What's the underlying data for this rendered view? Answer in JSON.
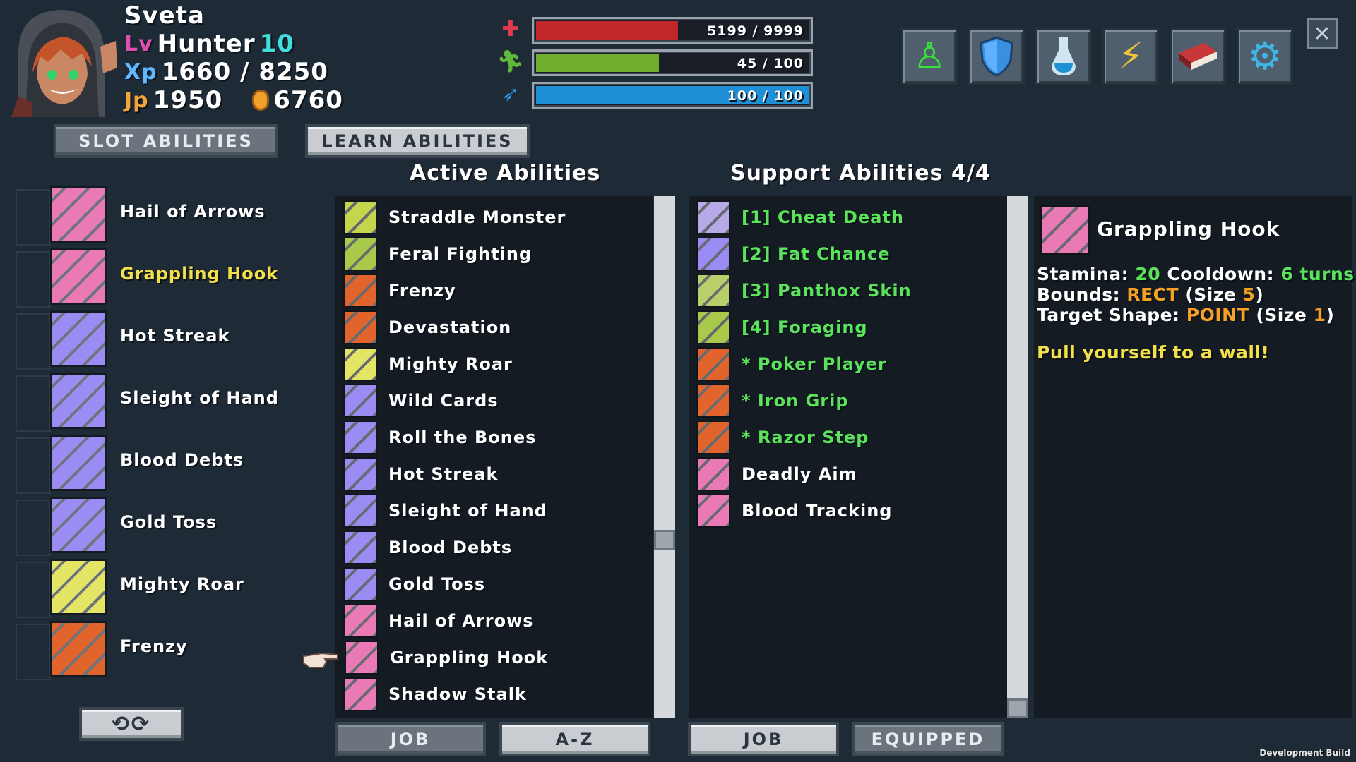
{
  "character": {
    "name": "Sveta",
    "lv_tag": "Lv",
    "job": "Hunter",
    "level": "10",
    "xp_tag": "Xp",
    "xp": "1660 / 8250",
    "jp_tag": "Jp",
    "jp": "1950",
    "gold": "6760"
  },
  "stats": {
    "hp": {
      "text": "5199 / 9999",
      "fraction": 0.52,
      "color": "#c0262a",
      "icon": "plus-icon"
    },
    "stamina": {
      "text": "45 / 100",
      "fraction": 0.45,
      "color": "#6fae2c",
      "icon": "running-man-icon"
    },
    "mana": {
      "text": "100 / 100",
      "fraction": 1.0,
      "color": "#1f8fd6",
      "icon": "feather-icon"
    }
  },
  "top_icons": [
    "character-icon",
    "shield-icon",
    "potion-icon",
    "skills-icon",
    "spellbook-icon",
    "settings-icon"
  ],
  "tabs": {
    "slot": "SLOT ABILITIES",
    "learn": "LEARN ABILITIES"
  },
  "headings": {
    "active": "Active Abilities",
    "support": "Support Abilities 4/4"
  },
  "slotted": [
    {
      "label": "Hail of Arrows",
      "color": "#e97ab6",
      "highlight": false
    },
    {
      "label": "Grappling Hook",
      "color": "#e97ab6",
      "highlight": true
    },
    {
      "label": "Hot Streak",
      "color": "#9a8cf2",
      "highlight": false
    },
    {
      "label": "Sleight of Hand",
      "color": "#9a8cf2",
      "highlight": false
    },
    {
      "label": "Blood Debts",
      "color": "#9a8cf2",
      "highlight": false
    },
    {
      "label": "Gold Toss",
      "color": "#9a8cf2",
      "highlight": false
    },
    {
      "label": "Mighty Roar",
      "color": "#e4e465",
      "highlight": false
    },
    {
      "label": "Frenzy",
      "color": "#e2642d",
      "highlight": false
    }
  ],
  "active_list": [
    {
      "label": "Straddle Monster",
      "color": "#c6d64c"
    },
    {
      "label": "Feral Fighting",
      "color": "#a8c94a"
    },
    {
      "label": "Frenzy",
      "color": "#e2642d"
    },
    {
      "label": "Devastation",
      "color": "#e2642d"
    },
    {
      "label": "Mighty Roar",
      "color": "#e4e465"
    },
    {
      "label": "Wild Cards",
      "color": "#9a8cf2"
    },
    {
      "label": "Roll the Bones",
      "color": "#9a8cf2"
    },
    {
      "label": "Hot Streak",
      "color": "#9a8cf2"
    },
    {
      "label": "Sleight of Hand",
      "color": "#9a8cf2"
    },
    {
      "label": "Blood Debts",
      "color": "#9a8cf2"
    },
    {
      "label": "Gold Toss",
      "color": "#9a8cf2"
    },
    {
      "label": "Hail of Arrows",
      "color": "#e97ab6"
    },
    {
      "label": "Grappling Hook",
      "color": "#e97ab6"
    },
    {
      "label": "Shadow Stalk",
      "color": "#e97ab6"
    }
  ],
  "support_list": [
    {
      "label": "[1] Cheat Death",
      "color": "#b7a8e8",
      "equipped": true
    },
    {
      "label": "[2] Fat Chance",
      "color": "#9a8cf2",
      "equipped": true
    },
    {
      "label": "[3] Panthox Skin",
      "color": "#b9cf6a",
      "equipped": true
    },
    {
      "label": "[4] Foraging",
      "color": "#a8c94a",
      "equipped": true
    },
    {
      "label": "* Poker Player",
      "color": "#e2642d",
      "equipped": true
    },
    {
      "label": "* Iron Grip",
      "color": "#e2642d",
      "equipped": true
    },
    {
      "label": "* Razor Step",
      "color": "#e2642d",
      "equipped": true
    },
    {
      "label": "Deadly Aim",
      "color": "#e97ab6",
      "equipped": false
    },
    {
      "label": "Blood Tracking",
      "color": "#e97ab6",
      "equipped": false
    }
  ],
  "detail": {
    "name": "Grappling Hook",
    "stamina_label": "Stamina:",
    "stamina_value": "20",
    "cooldown_label": "Cooldown:",
    "cooldown_value": "6 turns",
    "bounds_label": "Bounds:",
    "bounds_shape": "RECT",
    "bounds_size_open": "(Size ",
    "bounds_size": "5",
    "size_close": ")",
    "target_label": "Target Shape:",
    "target_shape": "POINT",
    "target_size_open": "(Size ",
    "target_size": "1",
    "description": "Pull yourself to a wall!"
  },
  "sort_buttons": {
    "active_job": "JOB",
    "active_az": "A-Z",
    "support_job": "JOB",
    "support_equipped": "EQUIPPED"
  },
  "footer": "Development Build"
}
